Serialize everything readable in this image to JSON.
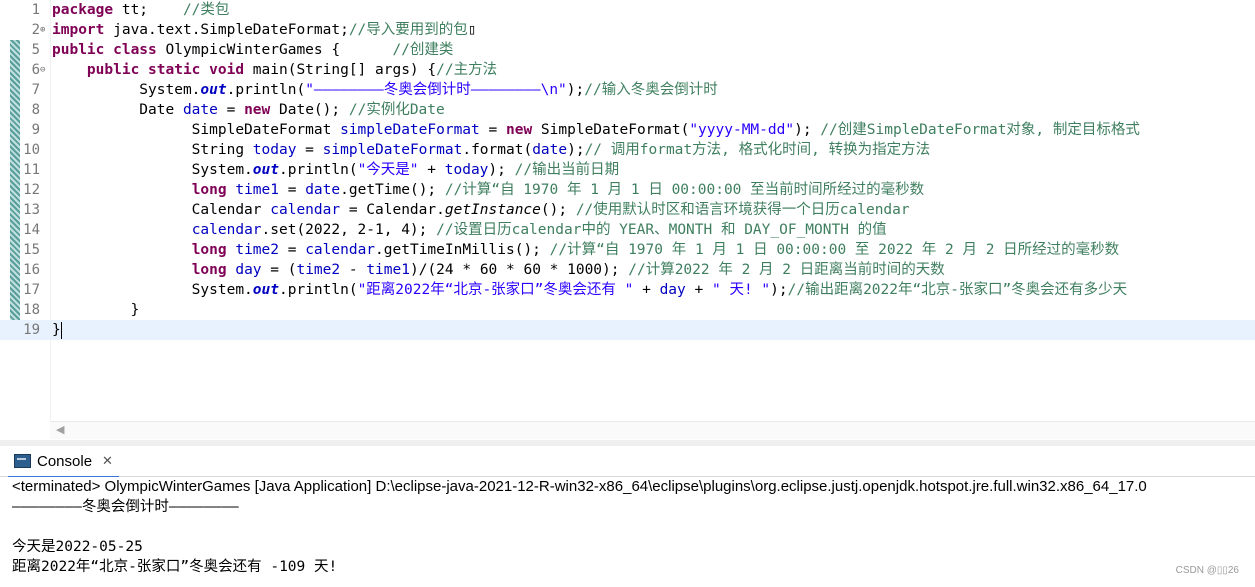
{
  "editor": {
    "lines": [
      {
        "n": "1",
        "parts": [
          [
            "kw",
            "package"
          ],
          [
            "t",
            " tt;    "
          ],
          [
            "cm",
            "//类包"
          ]
        ]
      },
      {
        "n": "2",
        "fold": "⊕",
        "parts": [
          [
            "kw",
            "import"
          ],
          [
            "t",
            " java.text.SimpleDateFormat;"
          ],
          [
            "cm",
            "//导入要用到的包"
          ],
          [
            "t",
            "▯"
          ]
        ]
      },
      {
        "n": "5",
        "parts": [
          [
            "kw",
            "public class"
          ],
          [
            "t",
            " OlympicWinterGames {      "
          ],
          [
            "cm",
            "//创建类"
          ]
        ]
      },
      {
        "n": "6",
        "fold": "⊖",
        "parts": [
          [
            "t",
            "    "
          ],
          [
            "kw",
            "public static void"
          ],
          [
            "t",
            " main(String[] args) {"
          ],
          [
            "cm",
            "//主方法"
          ]
        ]
      },
      {
        "n": "7",
        "parts": [
          [
            "t",
            "          System."
          ],
          [
            "st",
            "out"
          ],
          [
            "t",
            ".println("
          ],
          [
            "str",
            "\"————————冬奥会倒计时————————\\n\""
          ],
          [
            "t",
            ");"
          ],
          [
            "cm",
            "//输入冬奥会倒计时"
          ]
        ]
      },
      {
        "n": "8",
        "parts": [
          [
            "t",
            "          Date "
          ],
          [
            "fld",
            "date"
          ],
          [
            "t",
            " = "
          ],
          [
            "kw",
            "new"
          ],
          [
            "t",
            " Date(); "
          ],
          [
            "cm",
            "//实例化Date"
          ]
        ]
      },
      {
        "n": "9",
        "parts": [
          [
            "t",
            "                SimpleDateFormat "
          ],
          [
            "fld",
            "simpleDateFormat"
          ],
          [
            "t",
            " = "
          ],
          [
            "kw",
            "new"
          ],
          [
            "t",
            " SimpleDateFormat("
          ],
          [
            "str",
            "\"yyyy-MM-dd\""
          ],
          [
            "t",
            "); "
          ],
          [
            "cm",
            "//创建SimpleDateFormat对象, 制定目标格式"
          ]
        ]
      },
      {
        "n": "10",
        "parts": [
          [
            "t",
            "                String "
          ],
          [
            "fld",
            "today"
          ],
          [
            "t",
            " = "
          ],
          [
            "fld",
            "simpleDateFormat"
          ],
          [
            "t",
            ".format("
          ],
          [
            "fld",
            "date"
          ],
          [
            "t",
            ");"
          ],
          [
            "cm",
            "// 调用format方法, 格式化时间, 转换为指定方法"
          ]
        ]
      },
      {
        "n": "11",
        "parts": [
          [
            "t",
            "                System."
          ],
          [
            "st",
            "out"
          ],
          [
            "t",
            ".println("
          ],
          [
            "str",
            "\"今天是\""
          ],
          [
            "t",
            " + "
          ],
          [
            "fld",
            "today"
          ],
          [
            "t",
            "); "
          ],
          [
            "cm",
            "//输出当前日期"
          ]
        ]
      },
      {
        "n": "12",
        "parts": [
          [
            "t",
            "                "
          ],
          [
            "kw",
            "long"
          ],
          [
            "t",
            " "
          ],
          [
            "fld",
            "time1"
          ],
          [
            "t",
            " = "
          ],
          [
            "fld",
            "date"
          ],
          [
            "t",
            ".getTime(); "
          ],
          [
            "cm",
            "//计算“自 1970 年 1 月 1 日 00:00:00 至当前时间所经过的毫秒数"
          ]
        ]
      },
      {
        "n": "13",
        "parts": [
          [
            "t",
            "                Calendar "
          ],
          [
            "fld",
            "calendar"
          ],
          [
            "t",
            " = Calendar."
          ],
          [
            "sm",
            "getInstance"
          ],
          [
            "t",
            "(); "
          ],
          [
            "cm",
            "//使用默认时区和语言环境获得一个日历calendar"
          ]
        ]
      },
      {
        "n": "14",
        "parts": [
          [
            "t",
            "                "
          ],
          [
            "fld",
            "calendar"
          ],
          [
            "t",
            ".set(2022, 2-1, 4); "
          ],
          [
            "cm",
            "//设置日历calendar中的 YEAR、MONTH 和 DAY_OF_MONTH 的值"
          ]
        ]
      },
      {
        "n": "15",
        "parts": [
          [
            "t",
            "                "
          ],
          [
            "kw",
            "long"
          ],
          [
            "t",
            " "
          ],
          [
            "fld",
            "time2"
          ],
          [
            "t",
            " = "
          ],
          [
            "fld",
            "calendar"
          ],
          [
            "t",
            ".getTimeInMillis(); "
          ],
          [
            "cm",
            "//计算“自 1970 年 1 月 1 日 00:00:00 至 2022 年 2 月 2 日所经过的毫秒数"
          ]
        ]
      },
      {
        "n": "16",
        "parts": [
          [
            "t",
            "                "
          ],
          [
            "kw",
            "long"
          ],
          [
            "t",
            " "
          ],
          [
            "fld",
            "day"
          ],
          [
            "t",
            " = ("
          ],
          [
            "fld",
            "time2"
          ],
          [
            "t",
            " - "
          ],
          [
            "fld",
            "time1"
          ],
          [
            "t",
            ")/(24 * 60 * 60 * 1000); "
          ],
          [
            "cm",
            "//计算2022 年 2 月 2 日距离当前时间的天数"
          ]
        ]
      },
      {
        "n": "17",
        "parts": [
          [
            "t",
            "                System."
          ],
          [
            "st",
            "out"
          ],
          [
            "t",
            ".println("
          ],
          [
            "str",
            "\"距离2022年“北京-张家口”冬奥会还有 \""
          ],
          [
            "t",
            " + "
          ],
          [
            "fld",
            "day"
          ],
          [
            "t",
            " + "
          ],
          [
            "str",
            "\" 天! \""
          ],
          [
            "t",
            ");"
          ],
          [
            "cm",
            "//输出距离2022年“北京-张家口”冬奥会还有多少天"
          ]
        ]
      },
      {
        "n": "18",
        "parts": [
          [
            "t",
            "         }"
          ]
        ]
      },
      {
        "n": "19",
        "current": true,
        "parts": [
          [
            "t",
            "}"
          ]
        ]
      }
    ]
  },
  "console": {
    "tab_label": "Console",
    "tab_close": "✕",
    "status": "<terminated> OlympicWinterGames [Java Application] D:\\eclipse-java-2021-12-R-win32-x86_64\\eclipse\\plugins\\org.eclipse.justj.openjdk.hotspot.jre.full.win32.x86_64_17.0",
    "output": [
      "————————冬奥会倒计时————————",
      "",
      "今天是2022-05-25",
      "距离2022年“北京-张家口”冬奥会还有 -109 天!"
    ]
  },
  "watermark": "CSDN @▯▯26"
}
